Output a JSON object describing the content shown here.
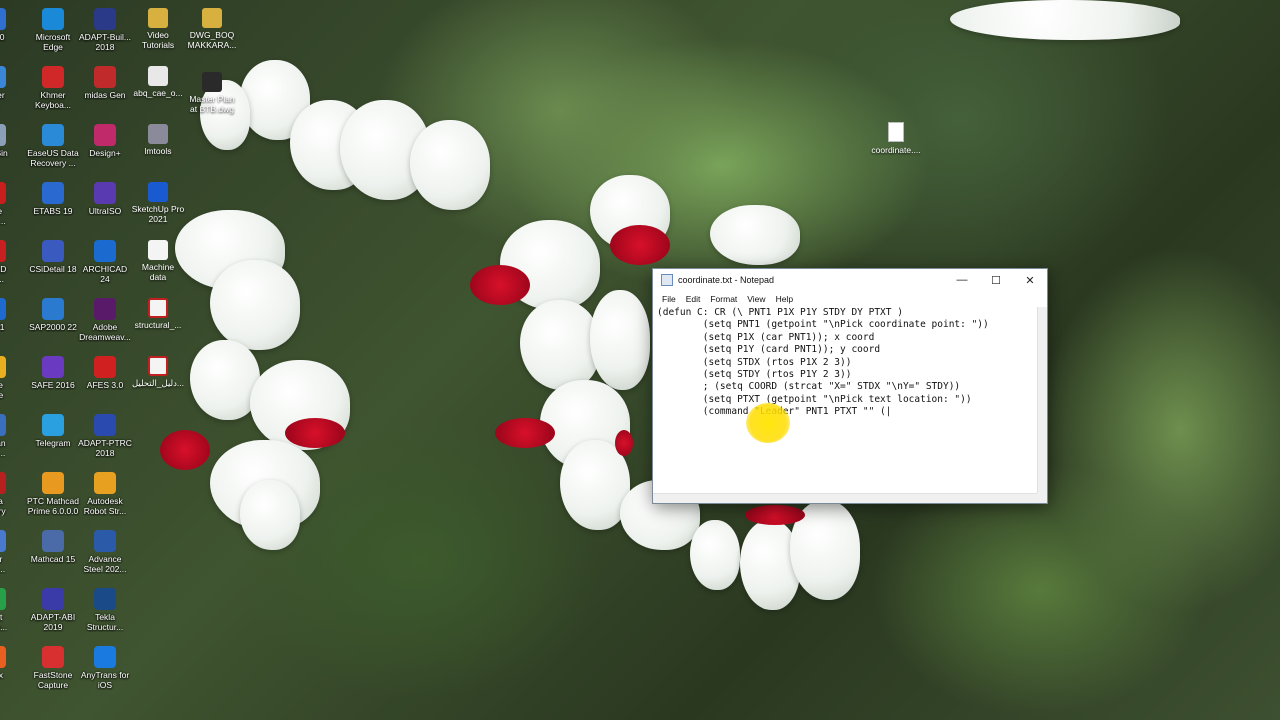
{
  "desktop": {
    "column1": [
      {
        "label": "7730",
        "color": "#2f6fd0"
      },
      {
        "label": "puter",
        "color": "#3a86d8"
      },
      {
        "label": "cle Bin",
        "color": "#8ba0b8"
      },
      {
        "label": "obe\nbat ...",
        "color": "#c81e1e"
      },
      {
        "label": "oCAD\n- E...",
        "color": "#c82020"
      },
      {
        "label": "2021",
        "color": "#1e6ad0"
      },
      {
        "label": "ogle\nome",
        "color": "#e8b020"
      },
      {
        "label": "gman\nanc...",
        "color": "#3a6fc0"
      },
      {
        "label": "xida\nonary",
        "color": "#b82020"
      },
      {
        "label": "mer\nish ...",
        "color": "#4a7ad0"
      },
      {
        "label": "rnet\nwnlo...",
        "color": "#28a048"
      },
      {
        "label": "efox",
        "color": "#e86020"
      }
    ],
    "column2": [
      {
        "label": "Microsoft\nEdge",
        "color": "#1a8ad8"
      },
      {
        "label": "Khmer\nKeyboa...",
        "color": "#d02828"
      },
      {
        "label": "EaseUS Data\nRecovery ...",
        "color": "#2a8ad8"
      },
      {
        "label": "ETABS 19",
        "color": "#2a6ad0"
      },
      {
        "label": "CSiDetail 18",
        "color": "#3a5ac0"
      },
      {
        "label": "SAP2000 22",
        "color": "#2a7ad0"
      },
      {
        "label": "SAFE 2016",
        "color": "#6a3ac0"
      },
      {
        "label": "Telegram",
        "color": "#2aa0e0"
      },
      {
        "label": "PTC Mathcad\nPrime 6.0.0.0",
        "color": "#e89a20"
      },
      {
        "label": "Mathcad 15",
        "color": "#4a6aa8"
      },
      {
        "label": "ADAPT-ABI\n2019",
        "color": "#3a3aa8"
      },
      {
        "label": "FastStone\nCapture",
        "color": "#d83030"
      }
    ],
    "column3": [
      {
        "label": "ADAPT-Buil...\n2018",
        "color": "#2a3a88"
      },
      {
        "label": "midas Gen",
        "color": "#c02a2a"
      },
      {
        "label": "Design+",
        "color": "#c02a6a"
      },
      {
        "label": "UltraISO",
        "color": "#5a3ab0"
      },
      {
        "label": "ARCHICAD\n24",
        "color": "#1a6ad0"
      },
      {
        "label": "Adobe\nDreamweav...",
        "color": "#5a1a6a"
      },
      {
        "label": "AFES 3.0",
        "color": "#d02020"
      },
      {
        "label": "ADAPT-PTRC\n2018",
        "color": "#2a4ab0"
      },
      {
        "label": "Autodesk\nRobot Str...",
        "color": "#e8a020"
      },
      {
        "label": "Advance\nSteel 202...",
        "color": "#2a5aa8"
      },
      {
        "label": "Tekla\nStructur...",
        "color": "#1a4a88"
      },
      {
        "label": "AnyTrans for\niOS",
        "color": "#1a7ae0"
      }
    ],
    "column4": [
      {
        "label": "Video\nTutorials",
        "color": "#d8b040"
      },
      {
        "label": "abq_cae_o...",
        "color": "#e8e8e8"
      },
      {
        "label": "lmtools",
        "color": "#8a8a9a"
      },
      {
        "label": "SketchUp Pro\n2021",
        "color": "#1a5ad0"
      },
      {
        "label": "Machine\ndata",
        "color": "#f4f4f4"
      },
      {
        "label": "structural_...",
        "color": "#f4f4f4"
      },
      {
        "label": "دليل_التحليل...",
        "color": "#f4f4f4"
      }
    ],
    "column5": [
      {
        "label": "DWG_BOQ\nMAKKARA...",
        "color": "#d8b040"
      },
      {
        "label": "Master Plan\nat BTB.dwg",
        "color": "#2a2a2a"
      }
    ],
    "file_icon": {
      "label": "coordinate...."
    }
  },
  "notepad": {
    "title": "coordinate.txt - Notepad",
    "menu": [
      "File",
      "Edit",
      "Format",
      "View",
      "Help"
    ],
    "minimize_glyph": "—",
    "maximize_glyph": "☐",
    "close_glyph": "✕",
    "lines": [
      "(defun C: CR (\\ PNT1 P1X P1Y STDY DY PTXT )",
      "        (setq PNT1 (getpoint \"\\nPick coordinate point: \"))",
      "        (setq P1X (car PNT1)); x coord",
      "        (setq P1Y (card PNT1)); y coord",
      "        (setq STDX (rtos P1X 2 3))",
      "        (setq STDY (rtos P1Y 2 3))",
      "        ; (setq COORD (strcat \"X=\" STDX \"\\nY=\" STDY))",
      "        (setq PTXT (getpoint \"\\nPick text location: \"))",
      "        (command \"Leader\" PNT1 PTXT \"\" (|"
    ]
  }
}
